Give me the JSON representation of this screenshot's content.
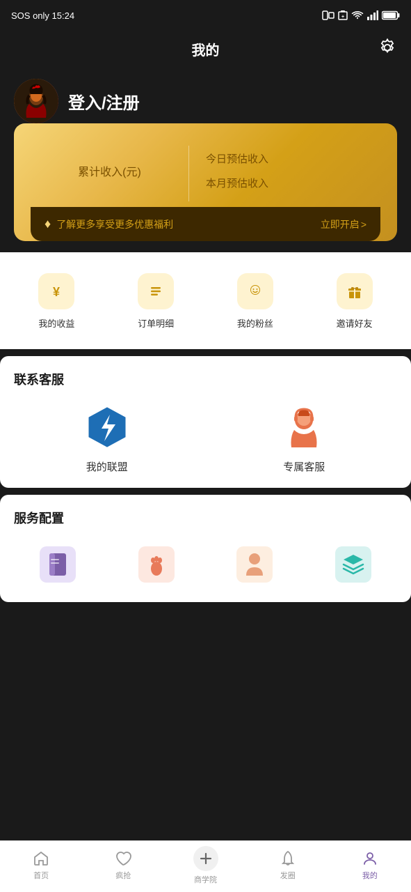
{
  "statusBar": {
    "left": "SOS only  15:24",
    "icons": [
      "nfc",
      "battery-saver",
      "wifi",
      "signal",
      "battery"
    ]
  },
  "header": {
    "title": "我的",
    "settingsLabel": "设置"
  },
  "userProfile": {
    "loginText": "登入/注册"
  },
  "earningsCard": {
    "cumulativeLabel": "累计收入(元)",
    "todayLabel": "今日预估收入",
    "monthLabel": "本月预估收入",
    "promoText": "了解更多享受更多优惠福利",
    "promoAction": "立即开启",
    "promoArrow": ">"
  },
  "quickActions": [
    {
      "label": "我的收益",
      "icon": "yuan"
    },
    {
      "label": "订单明细",
      "icon": "list"
    },
    {
      "label": "我的粉丝",
      "icon": "user-smile"
    },
    {
      "label": "邀请好友",
      "icon": "gift"
    }
  ],
  "contactSection": {
    "title": "联系客服",
    "items": [
      {
        "label": "我的联盟",
        "icon": "alliance"
      },
      {
        "label": "专属客服",
        "icon": "service"
      }
    ]
  },
  "serviceSection": {
    "title": "服务配置"
  },
  "bottomNav": [
    {
      "label": "首页",
      "icon": "home",
      "active": false
    },
    {
      "label": "疯抢",
      "icon": "heart",
      "active": false
    },
    {
      "label": "商学院",
      "icon": "plus",
      "active": false,
      "special": true
    },
    {
      "label": "发圈",
      "icon": "bell",
      "active": false
    },
    {
      "label": "我的",
      "icon": "person",
      "active": true
    }
  ],
  "tabIcons": {
    "book": "📗",
    "foot": "👣",
    "person": "👤",
    "layers": "🗂"
  }
}
